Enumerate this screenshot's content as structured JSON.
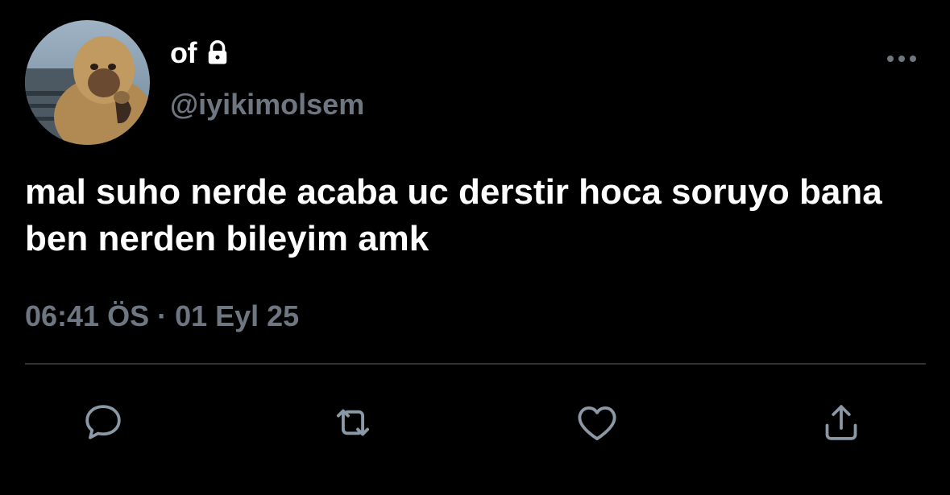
{
  "author": {
    "display_name": "of",
    "handle": "@iyikimolsem",
    "avatar_icon": "monkey-avatar",
    "protected_icon": "lock-icon"
  },
  "tweet": {
    "text": "mal suho nerde acaba uc derstir hoca soruyo bana ben nerden bileyim amk",
    "timestamp": "06:41 ÖS · 01 Eyl 25"
  },
  "actions": [
    {
      "name": "reply",
      "icon": "comment-icon"
    },
    {
      "name": "retweet",
      "icon": "retweet-icon"
    },
    {
      "name": "like",
      "icon": "heart-icon"
    },
    {
      "name": "share",
      "icon": "share-icon"
    }
  ],
  "colors": {
    "background": "#000000",
    "text": "#ffffff",
    "secondary": "#6e7681",
    "divider": "#2f3336"
  }
}
